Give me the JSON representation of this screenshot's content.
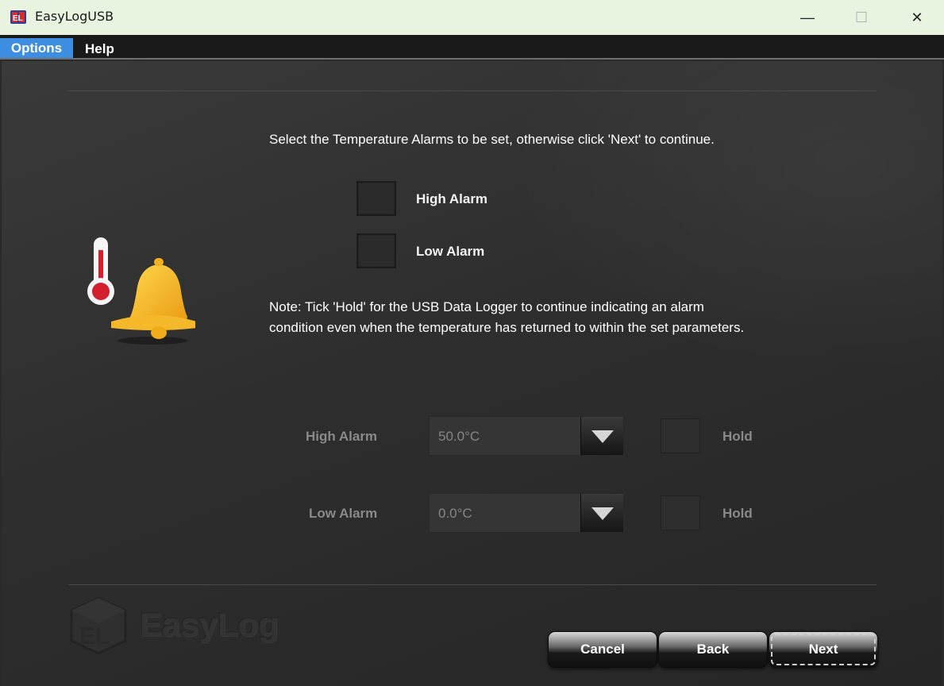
{
  "window": {
    "title": "EasyLogUSB",
    "minimize_glyph": "—",
    "maximize_glyph": "☐",
    "close_glyph": "✕"
  },
  "menu": {
    "items": [
      {
        "label": "Options",
        "active": true
      },
      {
        "label": "Help",
        "active": false
      }
    ],
    "active_color": "#3d8ee0"
  },
  "page": {
    "instruction": "Select the Temperature Alarms to be set, otherwise click 'Next' to continue.",
    "alarm_checkboxes": [
      {
        "label": "High Alarm",
        "checked": false
      },
      {
        "label": "Low Alarm",
        "checked": false
      }
    ],
    "note_line1": "Note: Tick 'Hold' for the USB Data Logger to continue indicating an alarm",
    "note_line2": "condition even when the temperature has returned to within the set parameters.",
    "illustration_icon": "thermometer-bell-icon"
  },
  "settings": {
    "high": {
      "label": "High Alarm",
      "value": "50.0°C",
      "hold_label": "Hold",
      "hold_checked": false,
      "enabled": false
    },
    "low": {
      "label": "Low Alarm",
      "value": "0.0°C",
      "hold_label": "Hold",
      "hold_checked": false,
      "enabled": false
    }
  },
  "footer": {
    "logo_text": "EasyLog",
    "buttons": {
      "cancel": "Cancel",
      "back": "Back",
      "next": "Next"
    }
  }
}
